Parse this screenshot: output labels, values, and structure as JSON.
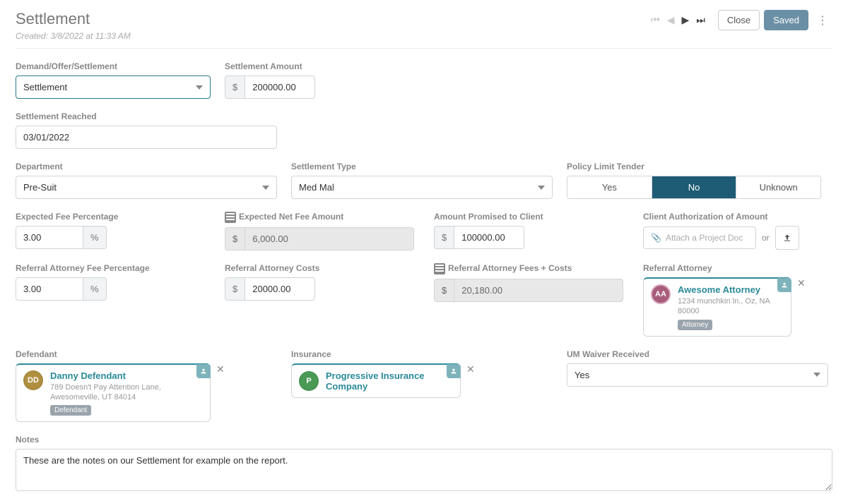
{
  "header": {
    "title": "Settlement",
    "created": "Created: 3/8/2022 at 11:33 AM",
    "close": "Close",
    "saved": "Saved"
  },
  "labels": {
    "demand": "Demand/Offer/Settlement",
    "settlement_amount": "Settlement Amount",
    "settlement_reached": "Settlement Reached",
    "department": "Department",
    "settlement_type": "Settlement Type",
    "policy_limit_tender": "Policy Limit Tender",
    "expected_fee_pct": "Expected Fee Percentage",
    "expected_net_fee": "Expected Net Fee Amount",
    "amount_promised": "Amount Promised to Client",
    "client_auth": "Client Authorization of Amount",
    "ref_atty_fee_pct": "Referral Attorney Fee Percentage",
    "ref_atty_costs": "Referral Attorney Costs",
    "ref_atty_fees_costs": "Referral Attorney Fees + Costs",
    "ref_atty": "Referral Attorney",
    "defendant": "Defendant",
    "insurance": "Insurance",
    "um_waiver": "UM Waiver Received",
    "notes": "Notes",
    "attach_placeholder": "Attach a Project Doc",
    "or": "or"
  },
  "values": {
    "demand": "Settlement",
    "settlement_amount": "200000.00",
    "settlement_reached": "03/01/2022",
    "department": "Pre-Suit",
    "settlement_type": "Med Mal",
    "policy_yes": "Yes",
    "policy_no": "No",
    "policy_unknown": "Unknown",
    "expected_fee_pct": "3.00",
    "pct": "%",
    "dollar": "$",
    "expected_net_fee": "6,000.00",
    "amount_promised": "100000.00",
    "ref_atty_fee_pct": "3.00",
    "ref_atty_costs": "20000.00",
    "ref_atty_fees_costs": "20,180.00",
    "um_waiver": "Yes",
    "notes": "These are the notes on our Settlement for example on the report."
  },
  "referral_attorney": {
    "initials": "AA",
    "name": "Awesome Attorney",
    "address": "1234 munchkin ln., Oz, NA 80000",
    "tag": "Attorney"
  },
  "defendant": {
    "initials": "DD",
    "name": "Danny Defendant",
    "address": "789 Doesn't Pay Attention Lane, Awesomeville, UT 84014",
    "tag": "Defendant"
  },
  "insurance": {
    "initials": "P",
    "name": "Progressive Insurance Company"
  }
}
